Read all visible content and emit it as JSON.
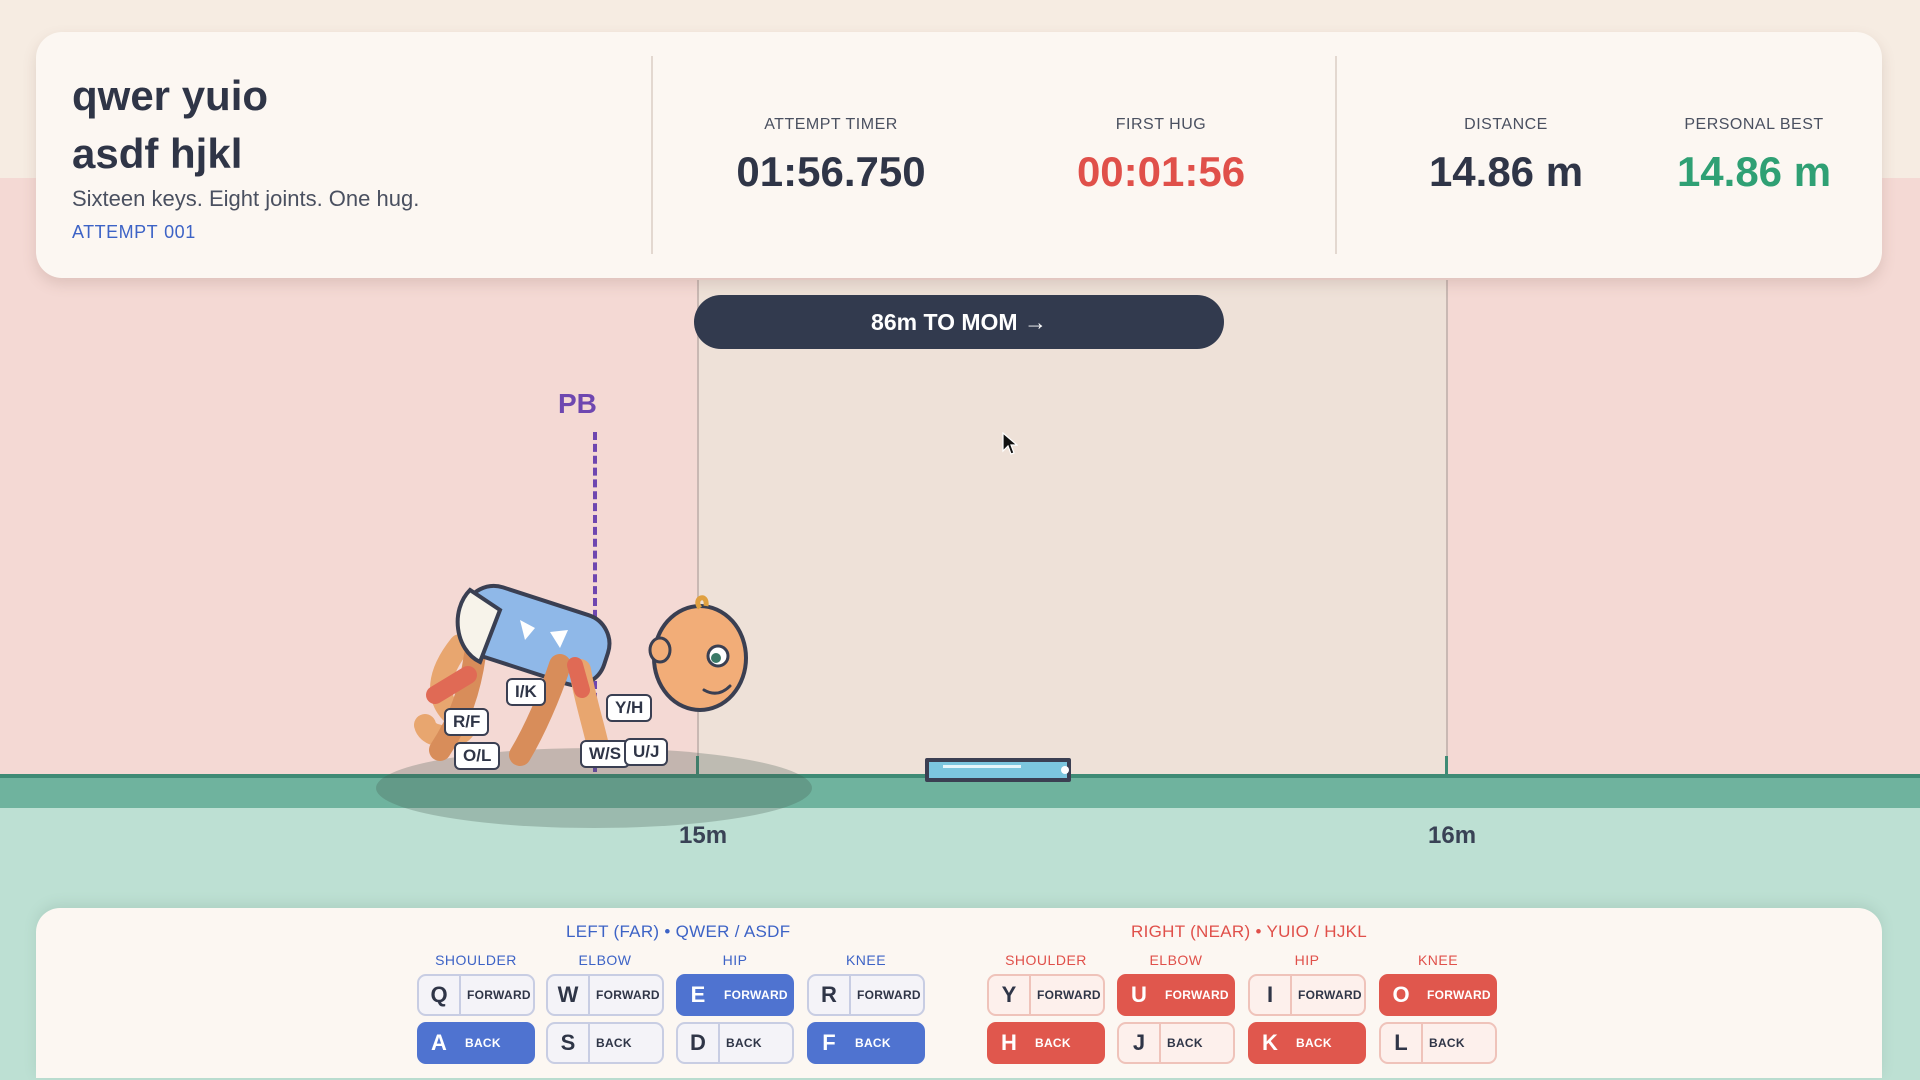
{
  "hud": {
    "title_line1": "qwer yuio",
    "title_line2": "asdf hjkl",
    "tagline": "Sixteen keys. Eight joints. One hug.",
    "attempt_label": "ATTEMPT",
    "attempt_number": "001",
    "stats": {
      "attempt_timer": {
        "label": "ATTEMPT TIMER",
        "value": "01:56.750"
      },
      "first_hug": {
        "label": "FIRST HUG",
        "value": "00:01:56"
      },
      "distance": {
        "label": "DISTANCE",
        "value": "14.86 m"
      },
      "personal_best": {
        "label": "PERSONAL BEST",
        "value": "14.86 m"
      }
    }
  },
  "banner": {
    "text": "86m TO MOM →"
  },
  "track": {
    "pb_label": "PB",
    "markers": [
      "15m",
      "16m"
    ]
  },
  "baby": {
    "labels": [
      "R/F",
      "I/K",
      "Y/H",
      "O/L",
      "W/S",
      "U/J"
    ]
  },
  "controls": {
    "left_header": "LEFT (FAR)  •  QWER / ASDF",
    "right_header": "RIGHT (NEAR)  •  YUIO / HJKL",
    "joints": [
      "SHOULDER",
      "ELBOW",
      "HIP",
      "KNEE"
    ],
    "forward_label": "FORWARD",
    "back_label": "BACK",
    "left_keys": {
      "forward": [
        "Q",
        "W",
        "E",
        "R"
      ],
      "back": [
        "A",
        "S",
        "D",
        "F"
      ],
      "forward_active": [
        false,
        false,
        true,
        false
      ],
      "back_active": [
        true,
        false,
        false,
        true
      ]
    },
    "right_keys": {
      "forward": [
        "Y",
        "U",
        "I",
        "O"
      ],
      "back": [
        "H",
        "J",
        "K",
        "L"
      ],
      "forward_active": [
        false,
        true,
        false,
        true
      ],
      "back_active": [
        true,
        false,
        true,
        false
      ]
    }
  },
  "colors": {
    "left_accent": "#4f73d0",
    "right_accent": "#e0574d",
    "pb_marker": "#6e47b0",
    "first_hug": "#e0504a",
    "personal_best": "#2fa074",
    "ground": "#6fb39e"
  }
}
